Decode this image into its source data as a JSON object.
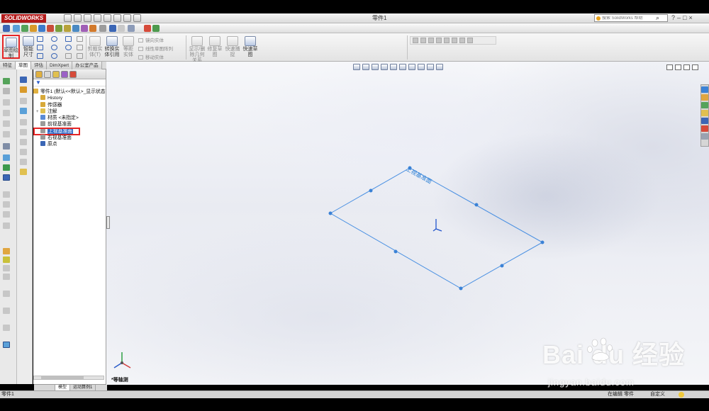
{
  "app": {
    "logo_text": "SOLIDWORKS",
    "doc_title": "零件1"
  },
  "search": {
    "placeholder": "搜索 SolidWorks 帮助",
    "button_glyph": "⌕"
  },
  "window_controls": [
    "?",
    "–",
    "□",
    "×"
  ],
  "ribbon": {
    "sketch_label": "草图绘制",
    "smart_dim_label": "智能尺寸",
    "buttons": [
      {
        "id": "trim",
        "label": "剪裁实体(T)"
      },
      {
        "id": "convert",
        "label": "转换实体引用"
      },
      {
        "id": "offset",
        "label": "等距实体"
      },
      {
        "id": "mirror",
        "label": "镜向实体"
      },
      {
        "id": "pattern",
        "label": "线性草图阵列"
      },
      {
        "id": "move",
        "label": "移动实体"
      },
      {
        "id": "relations",
        "label": "显示/删除几何关系"
      },
      {
        "id": "repair",
        "label": "修复草图"
      },
      {
        "id": "quick_snap",
        "label": "快速捕捉"
      },
      {
        "id": "rapid_sketch",
        "label": "快速草图"
      }
    ]
  },
  "cm_tabs": [
    "特征",
    "草图",
    "评估",
    "DimXpert",
    "办公室产品"
  ],
  "feature_tree": {
    "root": "零件1 (默认<<默认>_显示状态",
    "items": [
      {
        "label": "History",
        "icon_color": "#d7a93a",
        "expand": ""
      },
      {
        "label": "传感器",
        "icon_color": "#d7a93a",
        "expand": ""
      },
      {
        "label": "注解",
        "icon_color": "#e0c050",
        "expand": "+"
      },
      {
        "label": "材质 <未指定>",
        "icon_color": "#5b8bd6",
        "expand": ""
      },
      {
        "label": "前视基准面",
        "icon_color": "#9a9a9a",
        "expand": ""
      },
      {
        "label": "上视基准面",
        "icon_color": "#9a9a9a",
        "expand": "",
        "selected": true
      },
      {
        "label": "右视基准面",
        "icon_color": "#9a9a9a",
        "expand": ""
      },
      {
        "label": "原点",
        "icon_color": "#3b66b5",
        "expand": ""
      }
    ]
  },
  "bottom_tabs": [
    "模型",
    "运动算例1"
  ],
  "graphics": {
    "plane_label": "上视基准面",
    "view_label": "*等轴测"
  },
  "status_bar": {
    "left": "零件1",
    "edit": "在编辑 零件",
    "units": "自定义",
    "help_glyph": "?"
  },
  "watermark": {
    "logo": "Bai  du 经验",
    "url": "jingyan.baidu.com"
  },
  "colors": {
    "accent": "#3b82d6",
    "highlight_box": "#e52525",
    "selection": "#316ac5",
    "sketch_line": "#4a90e2"
  }
}
